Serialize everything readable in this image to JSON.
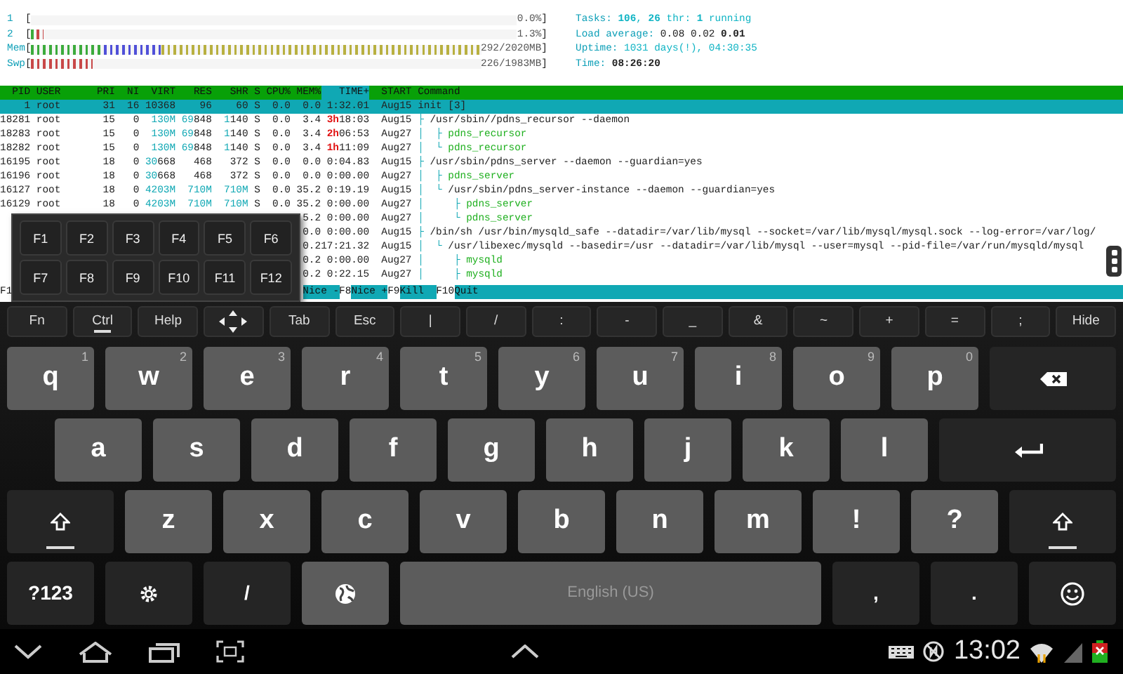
{
  "meters": [
    {
      "label": "1",
      "bracket_open": "[",
      "bracket_close": "]",
      "reading": "0.0%"
    },
    {
      "label": "2",
      "bracket_open": "[",
      "bracket_close": "]",
      "reading": "1.3%",
      "segments": [
        {
          "color": "#3cab3c",
          "level": 0.012
        },
        {
          "color": "#c84848",
          "level": 0.012
        }
      ]
    },
    {
      "label": "Mem",
      "bracket_open": "[",
      "bracket_close": "]",
      "reading": "292/2020MB",
      "segments": [
        {
          "color": "#3cab3c",
          "level": 0.16
        },
        {
          "color": "#5050d8",
          "level": 0.13
        },
        {
          "color": "#b8b040",
          "level": 0.71
        }
      ]
    },
    {
      "label": "Swp",
      "bracket_open": "[",
      "bracket_close": "]",
      "reading": "226/1983MB",
      "segments": [
        {
          "color": "#c84848",
          "level": 0.135
        }
      ]
    }
  ],
  "stats": [
    {
      "label": "Tasks:",
      "value": "**106**, **26** thr: **1** running",
      "color": "#10b4c4",
      "bold": false
    },
    {
      "label": "Load average:",
      "value": "0.08 0.02 **0.01**",
      "color": "#222222",
      "bold": false
    },
    {
      "label": "Uptime:",
      "value": "1031 days(!), 04:30:35",
      "color": "#10b4c4",
      "bold": false
    },
    {
      "label": "Time:",
      "value": "08:26:20",
      "color": "#222222",
      "bold": true
    }
  ],
  "columns": [
    {
      "label": "PID",
      "sorted": false
    },
    {
      "label": "USER",
      "sorted": false
    },
    {
      "label": "PRI",
      "sorted": false
    },
    {
      "label": "NI",
      "sorted": false
    },
    {
      "label": "VIRT",
      "sorted": false
    },
    {
      "label": "RES",
      "sorted": false
    },
    {
      "label": "SHR",
      "sorted": false
    },
    {
      "label": "S",
      "sorted": false
    },
    {
      "label": "CPU%",
      "sorted": false
    },
    {
      "label": "MEM%",
      "sorted": false
    },
    {
      "label": "TIME+",
      "sorted": true
    },
    {
      "label": "START",
      "sorted": false
    },
    {
      "label": "Command",
      "sorted": false
    }
  ],
  "processes": [
    {
      "selected": true,
      "pid": "1",
      "user": "root",
      "pri": "31",
      "ni": "16",
      "virt": "10368",
      "res": "96",
      "shr": "60",
      "state": "S",
      "cpu": "0.0",
      "mem": "0.0",
      "time": "1:32.01",
      "start": "Aug15",
      "command": "init [3]",
      "thread": false,
      "children": [
        {
          "selected": false,
          "pid": "18281",
          "user": "root",
          "pri": "15",
          "ni": "0",
          "virt": {
            "accent": "130M"
          },
          "res": {
            "accent": "69",
            "text": "848"
          },
          "shr": {
            "accent": "1",
            "text": "140"
          },
          "state": "S",
          "cpu": "0.0",
          "mem": "3.4",
          "time": {
            "hours": "3h",
            "text": "18:03"
          },
          "start": "Aug15",
          "branch": "├ ",
          "command": "/usr/sbin//pdns_recursor --daemon",
          "thread": false,
          "children": [
            {
              "selected": false,
              "pid": "18283",
              "user": "root",
              "pri": "15",
              "ni": "0",
              "virt": {
                "accent": "130M"
              },
              "res": {
                "accent": "69",
                "text": "848"
              },
              "shr": {
                "accent": "1",
                "text": "140"
              },
              "state": "S",
              "cpu": "0.0",
              "mem": "3.4",
              "time": {
                "hours": "2h",
                "text": "06:53"
              },
              "start": "Aug27",
              "branch": "│  ├ ",
              "command": "pdns_recursor",
              "thread": true
            },
            {
              "selected": false,
              "pid": "18282",
              "user": "root",
              "pri": "15",
              "ni": "0",
              "virt": {
                "accent": "130M"
              },
              "res": {
                "accent": "69",
                "text": "848"
              },
              "shr": {
                "accent": "1",
                "text": "140"
              },
              "state": "S",
              "cpu": "0.0",
              "mem": "3.4",
              "time": {
                "hours": "1h",
                "text": "11:09"
              },
              "start": "Aug27",
              "branch": "│  └ ",
              "command": "pdns_recursor",
              "thread": true
            }
          ]
        },
        {
          "selected": false,
          "pid": "16195",
          "user": "root",
          "pri": "18",
          "ni": "0",
          "virt": {
            "accent": "30",
            "text": "668"
          },
          "res": "468",
          "shr": "372",
          "state": "S",
          "cpu": "0.0",
          "mem": "0.0",
          "time": "0:04.83",
          "start": "Aug15",
          "branch": "├ ",
          "command": "/usr/sbin/pdns_server --daemon --guardian=yes",
          "thread": false,
          "children": [
            {
              "selected": false,
              "pid": "16196",
              "user": "root",
              "pri": "18",
              "ni": "0",
              "virt": {
                "accent": "30",
                "text": "668"
              },
              "res": "468",
              "shr": "372",
              "state": "S",
              "cpu": "0.0",
              "mem": "0.0",
              "time": "0:00.00",
              "start": "Aug27",
              "branch": "│  ├ ",
              "command": "pdns_server",
              "thread": true
            },
            {
              "selected": false,
              "pid": "16127",
              "user": "root",
              "pri": "18",
              "ni": "0",
              "virt": {
                "accent": "4203M"
              },
              "res": {
                "accent": "710M"
              },
              "shr": {
                "accent": "710M"
              },
              "state": "S",
              "cpu": "0.0",
              "mem": "35.2",
              "time": "0:19.19",
              "start": "Aug15",
              "branch": "│  └ ",
              "command": "/usr/sbin/pdns_server-instance --daemon --guardian=yes",
              "thread": false,
              "children": [
                {
                  "selected": false,
                  "pid": "16129",
                  "user": "root",
                  "pri": "18",
                  "ni": "0",
                  "virt": {
                    "accent": "4203M"
                  },
                  "res": {
                    "accent": "710M"
                  },
                  "shr": {
                    "accent": "710M"
                  },
                  "state": "S",
                  "cpu": "0.0",
                  "mem": "35.2",
                  "time": "0:00.00",
                  "start": "Aug27",
                  "branch": "│     ├ ",
                  "command": "pdns_server",
                  "thread": true
                },
                {
                  "selected": false,
                  "mem": "5.2",
                  "time": "0:00.00",
                  "start": "Aug27",
                  "branch": "│     └ ",
                  "command": "pdns_server",
                  "thread": true
                }
              ]
            }
          ]
        },
        {
          "selected": false,
          "mem": "0.0",
          "time": "0:00.00",
          "start": "Aug15",
          "branch": "├ ",
          "command": "/bin/sh /usr/bin/mysqld_safe --datadir=/var/lib/mysql --socket=/var/lib/mysql/mysql.sock --log-error=/var/log/",
          "thread": false,
          "children": [
            {
              "selected": false,
              "mem": "0.2",
              "time": "17:21.32",
              "start": "Aug15",
              "branch": "│  └ ",
              "command": "/usr/libexec/mysqld --basedir=/usr --datadir=/var/lib/mysql --user=mysql --pid-file=/var/run/mysqld/mysql",
              "thread": false,
              "children": [
                {
                  "selected": false,
                  "mem": "0.2",
                  "time": "0:00.00",
                  "start": "Aug27",
                  "branch": "│     ├ ",
                  "command": "mysqld",
                  "thread": true
                },
                {
                  "selected": false,
                  "mem": "0.2",
                  "time": "0:22.15",
                  "start": "Aug27",
                  "branch": "│     ├ ",
                  "command": "mysqld",
                  "thread": true
                }
              ]
            }
          ]
        }
      ]
    }
  ],
  "function_bar": {
    "left": [
      {
        "key": "F1"
      }
    ],
    "right": [
      {
        "label": "Nice -"
      },
      {
        "key": "F8",
        "label": "Nice +"
      },
      {
        "key": "F9",
        "label": "Kill  "
      },
      {
        "key": "F10",
        "label": "Quit"
      }
    ]
  },
  "fkey_popup": [
    [
      "F1",
      "F2",
      "F3",
      "F4",
      "F5",
      "F6"
    ],
    [
      "F7",
      "F8",
      "F9",
      "F10",
      "F11",
      "F12"
    ]
  ],
  "keyboard": {
    "function_row": [
      {
        "label": "Fn",
        "indicator": false
      },
      {
        "label": "Ctrl",
        "indicator": true
      },
      {
        "label": "Help",
        "indicator": false
      },
      {
        "kind": "arrows",
        "indicator": false
      },
      {
        "label": "Tab",
        "indicator": false
      },
      {
        "label": "Esc",
        "indicator": false
      },
      {
        "label": "|",
        "indicator": false
      },
      {
        "label": "/",
        "indicator": false
      },
      {
        "label": ":",
        "indicator": false
      },
      {
        "label": "-",
        "indicator": false
      },
      {
        "label": "_",
        "indicator": false
      },
      {
        "label": "&",
        "indicator": false
      },
      {
        "label": "~",
        "indicator": false
      },
      {
        "label": "+",
        "indicator": false
      },
      {
        "label": "=",
        "indicator": false
      },
      {
        "label": ";",
        "indicator": false
      },
      {
        "label": "Hide",
        "indicator": false
      }
    ],
    "rows": [
      [
        {
          "kind": "letter",
          "label": "q",
          "hint": "1"
        },
        {
          "kind": "letter",
          "label": "w",
          "hint": "2"
        },
        {
          "kind": "letter",
          "label": "e",
          "hint": "3"
        },
        {
          "kind": "letter",
          "label": "r",
          "hint": "4"
        },
        {
          "kind": "letter",
          "label": "t",
          "hint": "5"
        },
        {
          "kind": "letter",
          "label": "y",
          "hint": "6"
        },
        {
          "kind": "letter",
          "label": "u",
          "hint": "7"
        },
        {
          "kind": "letter",
          "label": "i",
          "hint": "8"
        },
        {
          "kind": "letter",
          "label": "o",
          "hint": "9"
        },
        {
          "kind": "letter",
          "label": "p",
          "hint": "0"
        },
        {
          "kind": "backspace"
        }
      ],
      [
        {
          "kind": "letter",
          "label": "a"
        },
        {
          "kind": "letter",
          "label": "s"
        },
        {
          "kind": "letter",
          "label": "d"
        },
        {
          "kind": "letter",
          "label": "f"
        },
        {
          "kind": "letter",
          "label": "g"
        },
        {
          "kind": "letter",
          "label": "h"
        },
        {
          "kind": "letter",
          "label": "j"
        },
        {
          "kind": "letter",
          "label": "k"
        },
        {
          "kind": "letter",
          "label": "l"
        },
        {
          "kind": "enter"
        }
      ],
      [
        {
          "kind": "shift",
          "indicator": true
        },
        {
          "kind": "letter",
          "label": "z"
        },
        {
          "kind": "letter",
          "label": "x"
        },
        {
          "kind": "letter",
          "label": "c"
        },
        {
          "kind": "letter",
          "label": "v"
        },
        {
          "kind": "letter",
          "label": "b"
        },
        {
          "kind": "letter",
          "label": "n"
        },
        {
          "kind": "letter",
          "label": "m"
        },
        {
          "kind": "letter",
          "label": "!"
        },
        {
          "kind": "letter",
          "label": "?"
        },
        {
          "kind": "shift",
          "indicator": true
        }
      ],
      [
        {
          "kind": "symbol",
          "label": "?123"
        },
        {
          "kind": "settings"
        },
        {
          "kind": "symbol",
          "label": "/"
        },
        {
          "kind": "language"
        },
        {
          "kind": "space",
          "label": "English (US)"
        },
        {
          "kind": "symbol",
          "label": ","
        },
        {
          "kind": "symbol",
          "label": "."
        },
        {
          "kind": "emoji"
        }
      ]
    ]
  },
  "system_bar": {
    "time": "13:02"
  }
}
